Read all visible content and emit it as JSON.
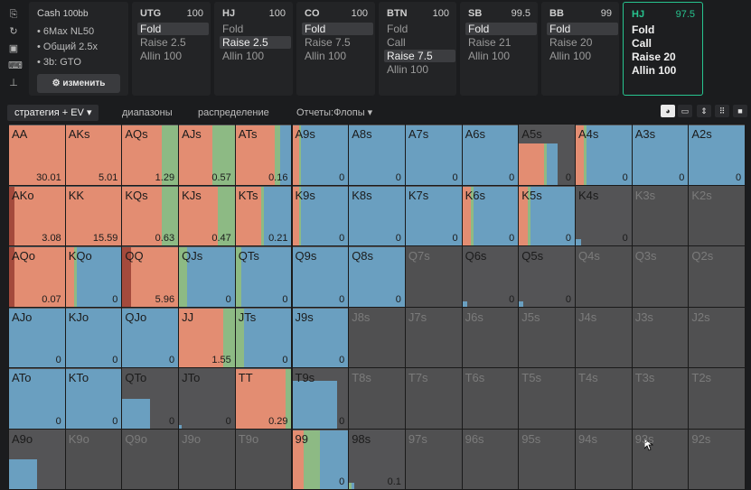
{
  "info_panel": {
    "title": "Cash",
    "stack": "100bb",
    "lines": [
      "• 6Max NL50",
      "• Общий 2.5x",
      "• 3b: GTO"
    ],
    "edit_button": "⚙ изменить"
  },
  "positions": [
    {
      "name": "UTG",
      "stack": "100",
      "actions": [
        "Fold",
        "Raise 2.5",
        "Allin 100"
      ],
      "selected": 0
    },
    {
      "name": "HJ",
      "stack": "100",
      "actions": [
        "Fold",
        "Raise 2.5",
        "Allin 100"
      ],
      "selected": 1
    },
    {
      "name": "CO",
      "stack": "100",
      "actions": [
        "Fold",
        "Raise 7.5",
        "Allin 100"
      ],
      "selected": 0
    },
    {
      "name": "BTN",
      "stack": "100",
      "actions": [
        "Fold",
        "Call",
        "Raise 7.5",
        "Allin 100"
      ],
      "selected": 2
    },
    {
      "name": "SB",
      "stack": "99.5",
      "actions": [
        "Fold",
        "Raise 21",
        "Allin 100"
      ],
      "selected": 0
    },
    {
      "name": "BB",
      "stack": "99",
      "actions": [
        "Fold",
        "Raise 20",
        "Allin 100"
      ],
      "selected": 0
    },
    {
      "name": "HJ",
      "stack": "97.5",
      "actions": [
        "Fold",
        "Call",
        "Raise 20",
        "Allin 100"
      ],
      "selected": -1,
      "active": true
    }
  ],
  "tabs": [
    "стратегия + EV ▾",
    "диапазоны",
    "распределение",
    "Отчеты:Флопы ▾"
  ],
  "view_icons": [
    "pie-icon",
    "split-icon",
    "expand-icon",
    "grid-icon",
    "square-icon"
  ],
  "colors": {
    "fold": "#6a9fc0",
    "call": "#8dba84",
    "raise": "#e38d72",
    "allin": "#a44a3c",
    "empty": "#545456",
    "dim_bg": "#505051"
  },
  "grid": {
    "rows": [
      [
        "AA",
        "AKs",
        "AQs",
        "AJs",
        "ATs",
        "A9s",
        "A8s",
        "A7s",
        "A6s",
        "A5s",
        "A4s",
        "A3s",
        "A2s"
      ],
      [
        "AKo",
        "KK",
        "KQs",
        "KJs",
        "KTs",
        "K9s",
        "K8s",
        "K7s",
        "K6s",
        "K5s",
        "K4s",
        "K3s",
        "K2s"
      ],
      [
        "AQo",
        "KQo",
        "QQ",
        "QJs",
        "QTs",
        "Q9s",
        "Q8s",
        "Q7s",
        "Q6s",
        "Q5s",
        "Q4s",
        "Q3s",
        "Q2s"
      ],
      [
        "AJo",
        "KJo",
        "QJo",
        "JJ",
        "JTs",
        "J9s",
        "J8s",
        "J7s",
        "J6s",
        "J5s",
        "J4s",
        "J3s",
        "J2s"
      ],
      [
        "ATo",
        "KTo",
        "QTo",
        "JTo",
        "TT",
        "T9s",
        "T8s",
        "T7s",
        "T6s",
        "T5s",
        "T4s",
        "T3s",
        "T2s"
      ],
      [
        "A9o",
        "K9o",
        "Q9o",
        "J9o",
        "T9o",
        "99",
        "98s",
        "97s",
        "96s",
        "95s",
        "94s",
        "93s",
        "92s"
      ]
    ],
    "values": [
      [
        "30.01",
        "5.01",
        "1.29",
        "0.57",
        "0.16",
        "0",
        "0",
        "0",
        "0",
        "0",
        "0",
        "0",
        "0"
      ],
      [
        "3.08",
        "15.59",
        "0.63",
        "0.47",
        "0.21",
        "0",
        "0",
        "0",
        "0",
        "0",
        "0",
        "",
        ""
      ],
      [
        "0.07",
        "0",
        "5.96",
        "0",
        "0",
        "0",
        "0",
        "",
        "0",
        "0",
        "",
        "",
        ""
      ],
      [
        "0",
        "0",
        "0",
        "1.55",
        "0",
        "0",
        "",
        "",
        "",
        "",
        "",
        "",
        ""
      ],
      [
        "0",
        "0",
        "0",
        "0",
        "0.29",
        "0",
        "",
        "",
        "",
        "",
        "",
        "",
        ""
      ],
      [
        "",
        "",
        "",
        "",
        "",
        "0",
        "0.1",
        "",
        "",
        "",
        "",
        "",
        ""
      ]
    ],
    "strategy": [
      [
        [
          0,
          0,
          1,
          0
        ],
        [
          0,
          0,
          1,
          0
        ],
        [
          0,
          0.3,
          0.7,
          0
        ],
        [
          0,
          0.4,
          0.6,
          0
        ],
        [
          0.2,
          0.1,
          0.7,
          0
        ],
        [
          0.85,
          0.03,
          0.12,
          0
        ],
        [
          1,
          0,
          0,
          0
        ],
        [
          1,
          0,
          0,
          0
        ],
        [
          1,
          0,
          0,
          0
        ],
        [
          0.2,
          0.05,
          0.45,
          0
        ],
        [
          0.8,
          0.05,
          0.15,
          0
        ],
        [
          1,
          0,
          0,
          0
        ],
        [
          1,
          0,
          0,
          0
        ]
      ],
      [
        [
          0,
          0,
          0.9,
          0.1
        ],
        [
          0,
          0,
          1,
          0
        ],
        [
          0,
          0.3,
          0.7,
          0
        ],
        [
          0,
          0.3,
          0.7,
          0
        ],
        [
          0.5,
          0.05,
          0.45,
          0
        ],
        [
          0.85,
          0.03,
          0.12,
          0
        ],
        [
          1,
          0,
          0,
          0
        ],
        [
          1,
          0,
          0,
          0
        ],
        [
          0.8,
          0.05,
          0.15,
          0
        ],
        [
          0.8,
          0.05,
          0.15,
          0
        ],
        [
          0.1,
          0,
          0,
          0
        ],
        [
          0,
          0,
          0,
          0
        ],
        [
          0,
          0,
          0,
          0
        ]
      ],
      [
        [
          0,
          0,
          0.9,
          0.1
        ],
        [
          0.8,
          0.05,
          0.15,
          0
        ],
        [
          0,
          0,
          0.85,
          0.15
        ],
        [
          0.85,
          0.15,
          0,
          0
        ],
        [
          0.9,
          0.1,
          0,
          0
        ],
        [
          1,
          0,
          0,
          0
        ],
        [
          1,
          0,
          0,
          0
        ],
        [
          0,
          0,
          0,
          0
        ],
        [
          0.08,
          0,
          0,
          0
        ],
        [
          0.08,
          0,
          0,
          0
        ],
        [
          0,
          0,
          0,
          0
        ],
        [
          0,
          0,
          0,
          0
        ],
        [
          0,
          0,
          0,
          0
        ]
      ],
      [
        [
          1,
          0,
          0,
          0
        ],
        [
          1,
          0,
          0,
          0
        ],
        [
          1,
          0,
          0,
          0
        ],
        [
          0,
          0.2,
          0.8,
          0
        ],
        [
          0.85,
          0.15,
          0,
          0
        ],
        [
          1,
          0,
          0,
          0
        ],
        [
          0,
          0,
          0,
          0
        ],
        [
          0,
          0,
          0,
          0
        ],
        [
          0,
          0,
          0,
          0
        ],
        [
          0,
          0,
          0,
          0
        ],
        [
          0,
          0,
          0,
          0
        ],
        [
          0,
          0,
          0,
          0
        ],
        [
          0,
          0,
          0,
          0
        ]
      ],
      [
        [
          1,
          0,
          0,
          0
        ],
        [
          1,
          0,
          0,
          0
        ],
        [
          0.5,
          0,
          0,
          0
        ],
        [
          0.05,
          0,
          0,
          0
        ],
        [
          0,
          0.1,
          0.9,
          0
        ],
        [
          0.8,
          0,
          0,
          0
        ],
        [
          0,
          0,
          0,
          0
        ],
        [
          0,
          0,
          0,
          0
        ],
        [
          0,
          0,
          0,
          0
        ],
        [
          0,
          0,
          0,
          0
        ],
        [
          0,
          0,
          0,
          0
        ],
        [
          0,
          0,
          0,
          0
        ],
        [
          0,
          0,
          0,
          0
        ]
      ],
      [
        [
          0.5,
          0,
          0,
          0
        ],
        [
          0,
          0,
          0,
          0
        ],
        [
          0,
          0,
          0,
          0
        ],
        [
          0,
          0,
          0,
          0
        ],
        [
          0,
          0,
          0,
          0
        ],
        [
          0.5,
          0.3,
          0.2,
          0
        ],
        [
          0.05,
          0.05,
          0,
          0
        ],
        [
          0,
          0,
          0,
          0
        ],
        [
          0,
          0,
          0,
          0
        ],
        [
          0,
          0,
          0,
          0
        ],
        [
          0,
          0,
          0,
          0
        ],
        [
          0,
          0,
          0,
          0
        ],
        [
          0,
          0,
          0,
          0
        ]
      ]
    ]
  }
}
